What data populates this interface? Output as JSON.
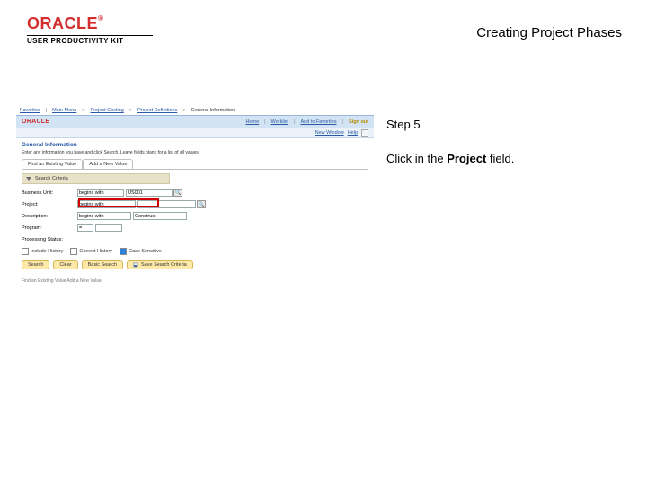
{
  "header": {
    "brand": "ORACLE",
    "brand_tm": "®",
    "subtitle": "USER PRODUCTIVITY KIT",
    "page_title": "Creating Project Phases"
  },
  "instruction": {
    "step_label": "Step 5",
    "text_prefix": "Click in the ",
    "text_bold": "Project",
    "text_suffix": " field."
  },
  "app": {
    "breadcrumb": {
      "items": [
        "Favorites",
        "Main Menu",
        "Project Costing",
        "Project Definitions",
        "General Information"
      ]
    },
    "subheader": {
      "logo": "ORACLE",
      "links": [
        "Home",
        "Worklist",
        "Add to Favorites"
      ],
      "signout": "Sign out"
    },
    "window": {
      "label": "New Window",
      "help": "Help"
    },
    "gi": {
      "title": "General Information",
      "subtitle": "Enter any information you have and click Search. Leave fields blank for a list of all values."
    },
    "tabs": {
      "find": "Find an Existing Value",
      "add": "Add a New Value"
    },
    "section": {
      "label": "Search Criteria"
    },
    "form": {
      "business_unit_lbl": "Business Unit:",
      "business_unit_val": "US001",
      "project_lbl": "Project:",
      "project_ph": "begins with",
      "description_lbl": "Description:",
      "description_ph": "begins with",
      "program_lbl": "Program:",
      "program_val": "=",
      "processing_lbl": "Processing Status:",
      "desc2_val": "Construct"
    },
    "checks": {
      "include_history": "Include History",
      "correct_history": "Correct History",
      "case_sensitive": "Case Sensitive"
    },
    "buttons": {
      "search": "Search",
      "clear": "Clear",
      "basic": "Basic Search",
      "save": "Save Search Criteria"
    },
    "ticker": "Find an Existing Value   Add a New Value"
  }
}
